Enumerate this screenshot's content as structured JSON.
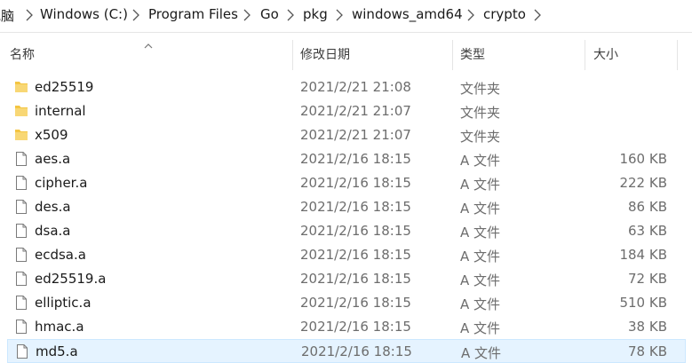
{
  "breadcrumb": {
    "items": [
      {
        "label": "电脑"
      },
      {
        "label": "Windows (C:)"
      },
      {
        "label": "Program Files"
      },
      {
        "label": "Go"
      },
      {
        "label": "pkg"
      },
      {
        "label": "windows_amd64"
      },
      {
        "label": "crypto"
      }
    ]
  },
  "header": {
    "name": "名称",
    "date": "修改日期",
    "type": "类型",
    "size": "大小"
  },
  "files": [
    {
      "name": "ed25519",
      "date": "2021/2/21 21:08",
      "type": "文件夹",
      "size": "",
      "kind": "folder"
    },
    {
      "name": "internal",
      "date": "2021/2/21 21:07",
      "type": "文件夹",
      "size": "",
      "kind": "folder"
    },
    {
      "name": "x509",
      "date": "2021/2/21 21:07",
      "type": "文件夹",
      "size": "",
      "kind": "folder"
    },
    {
      "name": "aes.a",
      "date": "2021/2/16 18:15",
      "type": "A 文件",
      "size": "160 KB",
      "kind": "file"
    },
    {
      "name": "cipher.a",
      "date": "2021/2/16 18:15",
      "type": "A 文件",
      "size": "222 KB",
      "kind": "file"
    },
    {
      "name": "des.a",
      "date": "2021/2/16 18:15",
      "type": "A 文件",
      "size": "86 KB",
      "kind": "file"
    },
    {
      "name": "dsa.a",
      "date": "2021/2/16 18:15",
      "type": "A 文件",
      "size": "63 KB",
      "kind": "file"
    },
    {
      "name": "ecdsa.a",
      "date": "2021/2/16 18:15",
      "type": "A 文件",
      "size": "184 KB",
      "kind": "file"
    },
    {
      "name": "ed25519.a",
      "date": "2021/2/16 18:15",
      "type": "A 文件",
      "size": "72 KB",
      "kind": "file"
    },
    {
      "name": "elliptic.a",
      "date": "2021/2/16 18:15",
      "type": "A 文件",
      "size": "510 KB",
      "kind": "file"
    },
    {
      "name": "hmac.a",
      "date": "2021/2/16 18:15",
      "type": "A 文件",
      "size": "38 KB",
      "kind": "file"
    },
    {
      "name": "md5.a",
      "date": "2021/2/16 18:15",
      "type": "A 文件",
      "size": "78 KB",
      "kind": "file",
      "selected": true
    }
  ],
  "colors": {
    "folder": "#f4c542",
    "selection_bg": "#e5f3ff",
    "selection_border": "#cce8ff",
    "muted_text": "#6d6d6d"
  },
  "icons": {
    "folder": "folder-icon",
    "file": "file-icon",
    "separator": "chevron-right-icon",
    "sort": "sort-ascending-icon"
  }
}
